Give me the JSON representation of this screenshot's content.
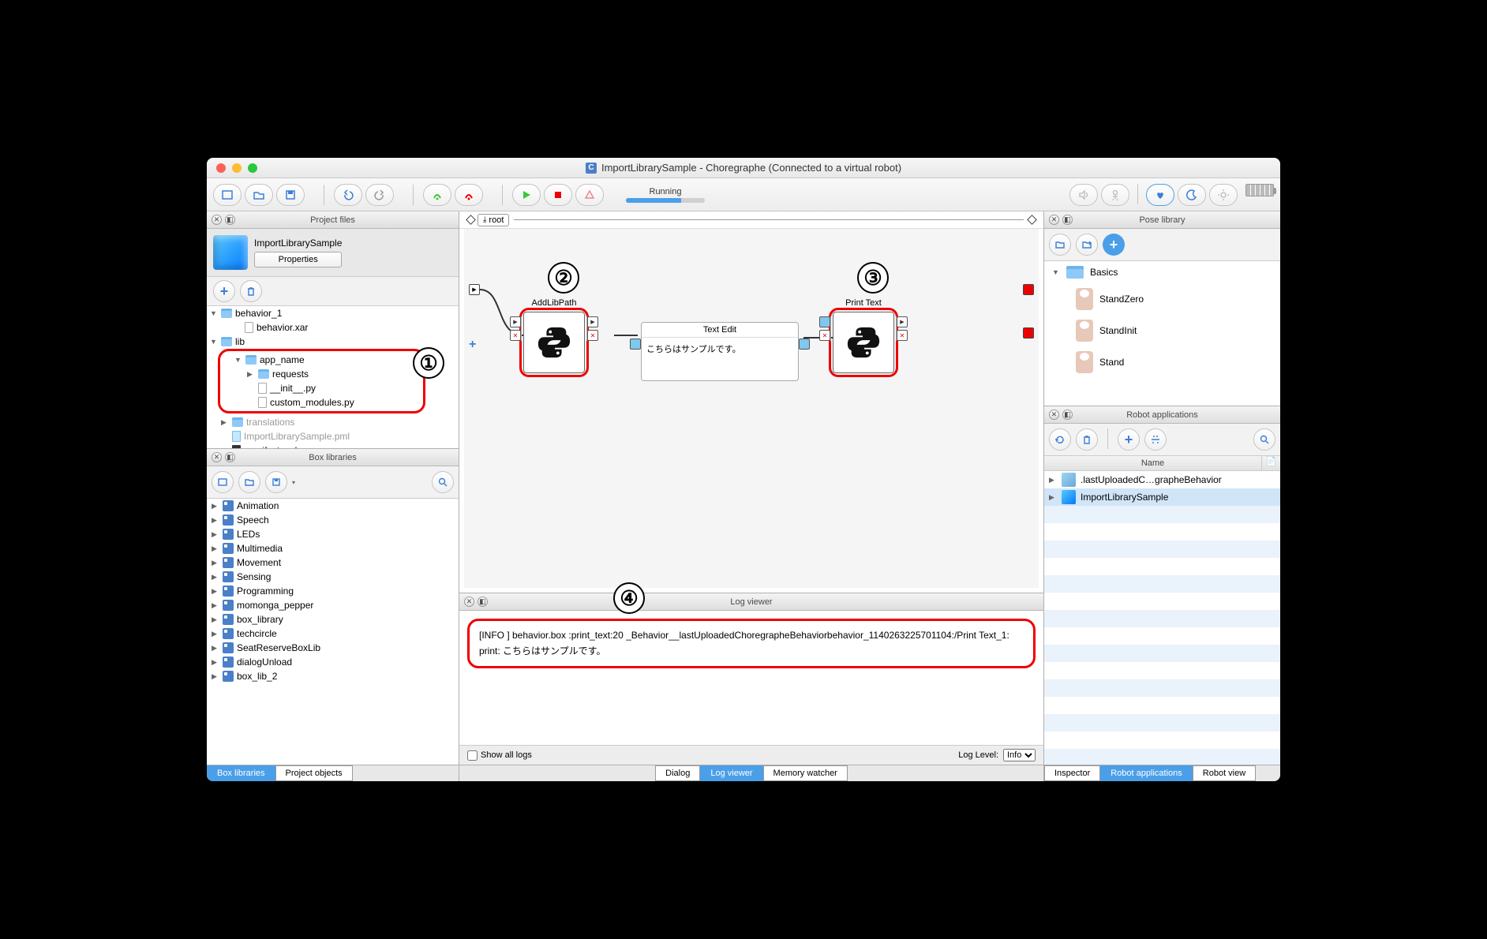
{
  "window": {
    "title": "ImportLibrarySample - Choregraphe (Connected to a virtual robot)"
  },
  "status": {
    "label": "Running"
  },
  "panels": {
    "project_files": "Project files",
    "box_libraries": "Box libraries",
    "pose_library": "Pose library",
    "robot_applications": "Robot applications",
    "log_viewer": "Log viewer"
  },
  "project": {
    "name": "ImportLibrarySample",
    "properties_btn": "Properties",
    "tree": {
      "behavior_1": "behavior_1",
      "behavior_xar": "behavior.xar",
      "lib": "lib",
      "app_name": "app_name",
      "requests": "requests",
      "init_py": "__init__.py",
      "custom_modules": "custom_modules.py",
      "translations": "translations",
      "pml": "ImportLibrarySample.pml",
      "manifest": "manifest.xml"
    }
  },
  "boxlib": {
    "items": [
      "Animation",
      "Speech",
      "LEDs",
      "Multimedia",
      "Movement",
      "Sensing",
      "Programming",
      "momonga_pepper",
      "box_library",
      "techcircle",
      "SeatReserveBoxLib",
      "dialogUnload",
      "box_lib_2"
    ]
  },
  "left_tabs": {
    "box_libraries": "Box libraries",
    "project_objects": "Project objects"
  },
  "canvas": {
    "root_label": "root",
    "nodes": {
      "addlibpath": "AddLibPath",
      "text_edit": "Text Edit",
      "text_edit_content": "こちらはサンプルです。",
      "print_text": "Print Text"
    }
  },
  "log": {
    "line": "[INFO ] behavior.box :print_text:20 _Behavior__lastUploadedChoregrapheBehaviorbehavior_1140263225701104:/Print Text_1: print: こちらはサンプルです。",
    "show_all": "Show all logs",
    "log_level_label": "Log Level:",
    "log_level_value": "Info"
  },
  "center_tabs": {
    "dialog": "Dialog",
    "log_viewer": "Log viewer",
    "memory_watcher": "Memory watcher"
  },
  "pose": {
    "basics": "Basics",
    "items": [
      "StandZero",
      "StandInit",
      "Stand"
    ]
  },
  "robotapps": {
    "name_col": "Name",
    "items": [
      {
        "label": ".lastUploadedC…grapheBehavior"
      },
      {
        "label": "ImportLibrarySample"
      }
    ]
  },
  "right_tabs": {
    "inspector": "Inspector",
    "robot_applications": "Robot applications",
    "robot_view": "Robot view"
  }
}
